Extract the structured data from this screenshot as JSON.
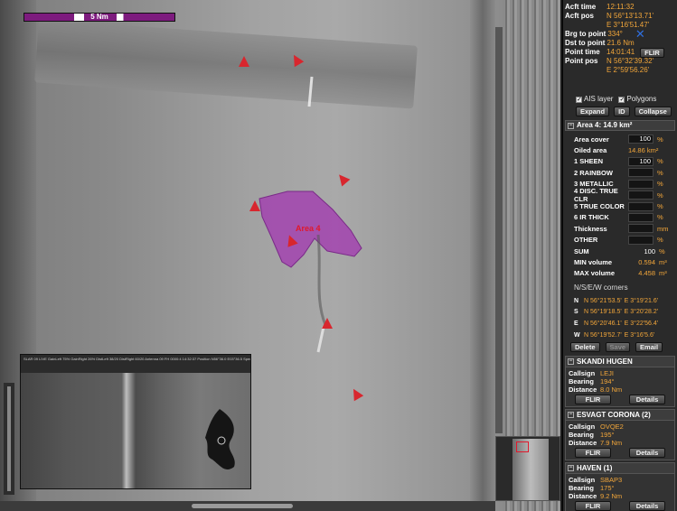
{
  "map": {
    "scale_label": "5 Nm",
    "area_label": "Area 4",
    "inset_header": "SLAR 09 LIVE   GainLeft 75%  GainRight 26%  DistLeft 38/20  DistRight 60/20  Antenna 09 FH   0000:4 14:32:37  Position N56°36.0 E03°36.5  Speed 99kt  Heading 284°"
  },
  "info": {
    "acft_time_label": "Acft time",
    "acft_time": "12:11:32",
    "acft_pos_label": "Acft pos",
    "acft_pos_n": "N 56°13'13.71'",
    "acft_pos_e": "E 3°16'51.47'",
    "brg_label": "Brg to point",
    "brg": "334°",
    "dst_label": "Dst to point",
    "dst": "21.6 Nm",
    "point_time_label": "Point time",
    "point_time": "14:01:41",
    "point_pos_label": "Point pos",
    "point_pos_n": "N 56°32'39.32'",
    "point_pos_e": "E 2°59'56.26'",
    "flir": "FLIR"
  },
  "layers": {
    "ais": "AIS layer",
    "polygons": "Polygons",
    "expand": "Expand",
    "id": "ID",
    "collapse": "Collapse"
  },
  "area": {
    "header": "Area 4: 14.9 km²",
    "area_cover_label": "Area cover",
    "area_cover": "100",
    "pct": "%",
    "oiled_area_label": "Oiled area",
    "oiled_area": "14.86 km²",
    "classes": [
      {
        "label": "1 SHEEN",
        "value": "100",
        "unit": "%"
      },
      {
        "label": "2 RAINBOW",
        "value": "",
        "unit": "%"
      },
      {
        "label": "3 METALLIC",
        "value": "",
        "unit": "%"
      },
      {
        "label": "4 DISC. TRUE CLR",
        "value": "",
        "unit": "%"
      },
      {
        "label": "5 TRUE COLOR",
        "value": "",
        "unit": "%"
      },
      {
        "label": "6 IR THICK",
        "value": "",
        "unit": "%"
      },
      {
        "label": "Thickness",
        "value": "",
        "unit": "mm"
      },
      {
        "label": "OTHER",
        "value": "",
        "unit": "%"
      }
    ],
    "sum_label": "SUM",
    "sum": "100",
    "sum_unit": "%",
    "min_label": "MIN volume",
    "min": "0.594",
    "min_unit": "m³",
    "max_label": "MAX volume",
    "max": "4.458",
    "max_unit": "m³",
    "corners_label": "N/S/E/W corners",
    "corners": [
      {
        "dir": "N",
        "lat": "N 56°21'53.5'",
        "lon": "E 3°19'21.6'"
      },
      {
        "dir": "S",
        "lat": "N 56°19'18.5'",
        "lon": "E 3°20'28.2'"
      },
      {
        "dir": "E",
        "lat": "N 56°20'46.1'",
        "lon": "E 3°22'56.4'"
      },
      {
        "dir": "W",
        "lat": "N 56°19'52.7'",
        "lon": "E 3°16'5.6'"
      }
    ],
    "delete": "Delete",
    "save": "Save",
    "email": "Email"
  },
  "vessels": [
    {
      "name": "SKANDI HUGEN",
      "callsign": "LEJI",
      "bearing": "194°",
      "distance": "8.0 Nm"
    },
    {
      "name": "ESVAGT CORONA  (2)",
      "callsign": "OVQE2",
      "bearing": "195°",
      "distance": "7.9 Nm"
    },
    {
      "name": "HAVEN  (1)",
      "callsign": "SBAP3",
      "bearing": "175°",
      "distance": "9.2 Nm"
    }
  ],
  "vessel_labels": {
    "callsign": "Callsign",
    "bearing": "Bearing",
    "distance": "Distance",
    "flir": "FLIR",
    "details": "Details"
  },
  "colors": {
    "accent": "#f2a63a",
    "polygon": "#a23fb0",
    "marker": "#d8262e"
  }
}
